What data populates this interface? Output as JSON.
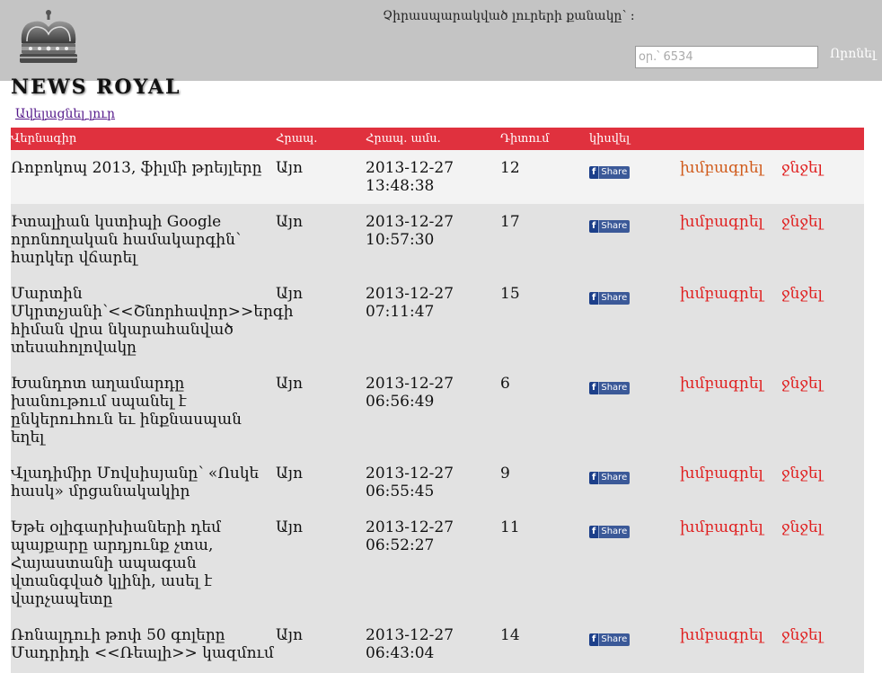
{
  "header": {
    "logo_text": "NEWS ROYAL",
    "unread_label": "Չիրասպարակված լուրերի քանակը՝ :",
    "search_placeholder": "օր.՝ 6534",
    "search_button": "Որոնել"
  },
  "toolbar": {
    "add_news": "Ավելացնել լուր"
  },
  "table": {
    "columns": [
      "Վերնագիր",
      "Հրապ.",
      "Հրապ. ամս.",
      "Դիտում",
      "կիսվել"
    ],
    "share_f": "f",
    "share_label": "Share",
    "edit_label": "խմբագրել",
    "delete_label": "ջնջել",
    "rows": [
      {
        "title": "Ռոբոկոպ 2013, ֆիլմի թրեյլերը",
        "published": "Այո",
        "date": "2013-12-27 13:48:38",
        "views": "12"
      },
      {
        "title": "Իտալիան կստիպի Google որոնողական համակարգին՝ հարկեր վճարել",
        "published": "Այո",
        "date": "2013-12-27 10:57:30",
        "views": "17"
      },
      {
        "title": "Մարտին Մկրտչյանի՝<<Շնորհավոր>>երգի հիման վրա նկարահանված տեսահոլովակը",
        "published": "Այո",
        "date": "2013-12-27 07:11:47",
        "views": "15"
      },
      {
        "title": "Խանդոտ աղամարդը խանութում սպանել է ընկերուհուն եւ ինքնասպան եղել",
        "published": "Այո",
        "date": "2013-12-27 06:56:49",
        "views": "6"
      },
      {
        "title": "Վլադիմիր Մովսիսյանը՝ «Ոսկե հասկ» մրցանակակիր",
        "published": "Այո",
        "date": "2013-12-27 06:55:45",
        "views": "9"
      },
      {
        "title": "Եթե օլիգարխիաների դեմ պայքարը արդյունք չտա, Հայաստանի ապագան վտանգված կլինի, ասել է վարչապետը",
        "published": "Այո",
        "date": "2013-12-27 06:52:27",
        "views": "11"
      },
      {
        "title": "Ռոնալդուի թոփ 50 գոլերը Մադրիդի <<Ռեալի>> կազմում",
        "published": "Այո",
        "date": "2013-12-27 06:43:04",
        "views": "14"
      }
    ]
  },
  "colors": {
    "header_bg": "#c4c4c4",
    "table_header_bg": "#e0313e",
    "action_red": "#e02020",
    "share_blue": "#3b5998"
  }
}
